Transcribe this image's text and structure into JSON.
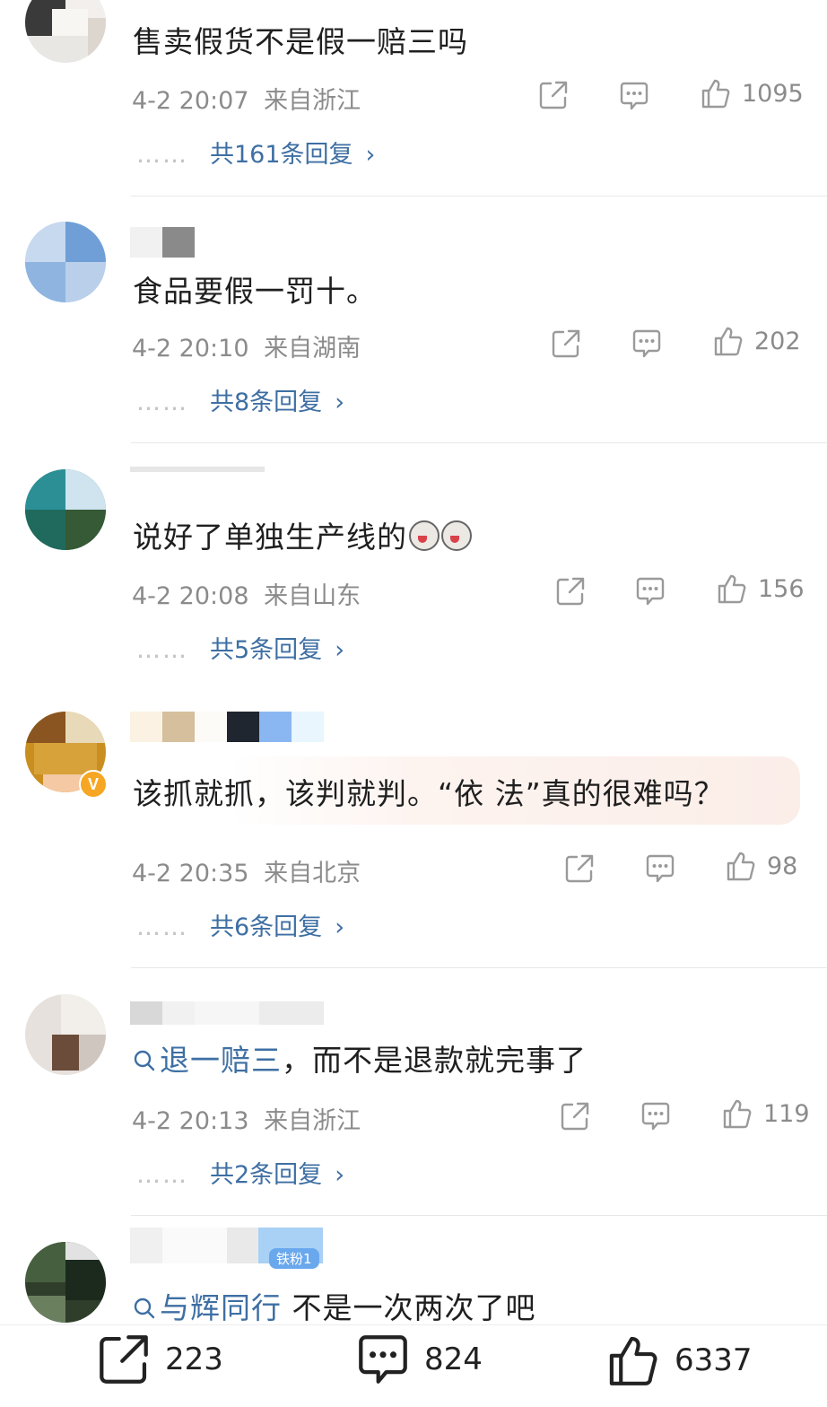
{
  "colors": {
    "link": "#3e6fa3",
    "meta": "#8b8b8b",
    "text": "#1f1f1f"
  },
  "comments": [
    {
      "text": "售卖假货不是假一赔三吗",
      "time": "4-2 20:07",
      "location": "来自浙江",
      "likes": "1095",
      "replies": "共161条回复"
    },
    {
      "text": "食品要假一罚十。",
      "time": "4-2 20:10",
      "location": "来自湖南",
      "likes": "202",
      "replies": "共8条回复"
    },
    {
      "text": "说好了单独生产线的",
      "time": "4-2 20:08",
      "location": "来自山东",
      "likes": "156",
      "replies": "共5条回复"
    },
    {
      "text": "该抓就抓，该判就判。“依 法”真的很难吗？",
      "time": "4-2 20:35",
      "location": "来自北京",
      "likes": "98",
      "replies": "共6条回复"
    },
    {
      "search_prefix": "退一赔三",
      "text": "，而不是退款就完事了",
      "time": "4-2 20:13",
      "location": "来自浙江",
      "likes": "119",
      "replies": "共2条回复"
    },
    {
      "search_prefix": "与辉同行",
      "text": " 不是一次两次了吧",
      "tag": "铁粉1"
    }
  ],
  "reply_dots": "……",
  "reply_chevron": "›",
  "icons": [
    "share-icon",
    "comment-icon",
    "like-icon",
    "search-icon",
    "verified-v-icon"
  ],
  "bottom_bar": {
    "shares": "223",
    "comments": "824",
    "likes": "6337"
  }
}
